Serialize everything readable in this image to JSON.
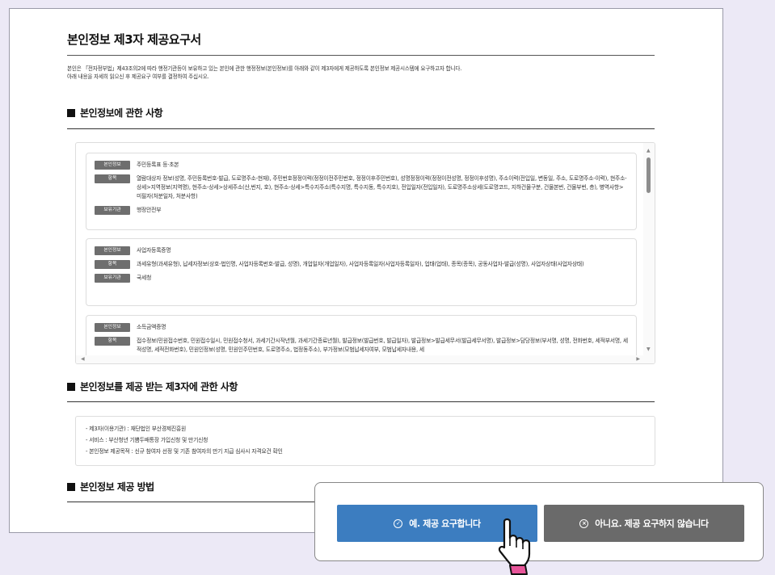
{
  "page": {
    "title": "본인정보 제3자 제공요구서",
    "intro_line1": "본인은 「전자정부법」제43조의2에 따라 행정기관등이 보유하고 있는 본인에 관한 행정정보(본인정보)를 아래와 같이 제3자에게 제공하도록 본인정보 제공시스템에 요구하고자 합니다.",
    "intro_line2": "아래 내용을 자세히 읽으신 후 제공요구 여부를 결정하여 주십시오."
  },
  "sections": {
    "info_title": "본인정보에 관한 사항",
    "third_title": "본인정보를 제공 받는 제3자에 관한 사항",
    "method_title": "본인정보 제공 방법"
  },
  "labels": {
    "info": "본인정보",
    "items": "항목",
    "holder": "보유기관"
  },
  "cards": [
    {
      "name": "주민등록표 등·초본",
      "items": "열람대상자 정보(성명, 주민등록번호-발급, 도로명주소-현재), 주민번호정정이력(정정이전주민번호, 정정이후주민번호), 성명정정이력(정정이전성명, 정정이후성명), 주소이력(전입일, 변동일, 주소, 도로명주소-이력), 현주소-상세>지역정보(지역명), 현주소-상세>상세주소(산,번지, 호), 현주소-상세>특수지주소(특수지명, 특수지동, 특수지호), 전입일자(전입일자), 도로명주소상세(도로명코드, 지하건물구분, 건물본번, 건물부번, 층), 병역사항>미필자(처분일자, 처분사항)",
      "holder": "행정안전부"
    },
    {
      "name": "사업자등록증명",
      "items": "과세유형(과세유형), 납세자정보(상호-법인명, 사업자등록번호-발급, 성명), 개업일자(개업일자), 사업자등록일자(사업자등록일자), 업태(업태), 종목(종목), 공동사업자-발급(성명), 사업자상태(사업자상태)",
      "holder": "국세청"
    },
    {
      "name": "소득금액증명",
      "items": "접수정보(민원접수번호, 민원접수일시, 민원접수청서, 과세기간시작년월, 과세기간종료년월), 발급정보(발급번호, 발급일자), 발급정보>발급세무서(발급세무서명), 발급정보>담당정보(부서명, 성명, 전화번호, 세적부서명, 세적성명, 세적전화번호), 민원인정보(성명, 민원인주민번호, 도로명주소, 법정동주소), 부가정보(모범납세자여부, 모범납세자내용, 세",
      "holder": ""
    }
  ],
  "third_party": [
    "- 제3자(이용기관) : 재단법인 부산경제진흥원",
    "- 서비스 : 부산청년 기쁨두배통장 가입신청 및 만기신청",
    "- 본인정보 제공목적 : 신규 참여자 선정 및 기존 참여자의 만기 지급 심사시 자격요건 확인"
  ],
  "dialog": {
    "yes_label": "예. 제공 요구합니다",
    "no_label": "아니요. 제공 요구하지 않습니다"
  },
  "icons": {
    "yes": "check-circle-icon",
    "no": "x-circle-icon",
    "cursor": "pointing-hand-cursor-icon"
  },
  "colors": {
    "yes_button": "#3c7dc0",
    "no_button": "#6a6a6a",
    "cursor_cuff": "#e8559a"
  }
}
